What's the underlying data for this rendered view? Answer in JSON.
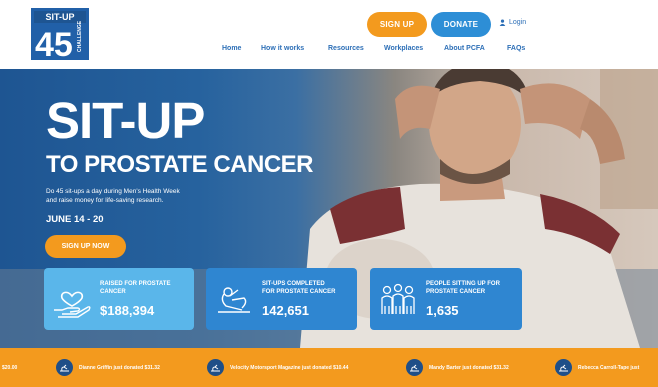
{
  "header": {
    "logo": {
      "top": "SIT-UP",
      "number": "45",
      "side": "CHALLENGE"
    },
    "signup_label": "SIGN UP",
    "donate_label": "DONATE",
    "login_label": "Login",
    "nav": [
      "Home",
      "How it works",
      "Resources",
      "Workplaces",
      "About PCFA",
      "FAQs"
    ]
  },
  "hero": {
    "title": "SIT-UP",
    "subtitle": "TO PROSTATE CANCER",
    "description_line1": "Do 45 sit-ups a day during Men's Health Week",
    "description_line2": "and raise money for life-saving research.",
    "dates": "JUNE 14 - 20",
    "cta_label": "SIGN UP NOW"
  },
  "stats": [
    {
      "label_line1": "RAISED FOR PROSTATE",
      "label_line2": "CANCER",
      "value": "$188,394",
      "icon": "heart-hand-icon"
    },
    {
      "label_line1": "SIT-UPS COMPLETED",
      "label_line2": "FOR PROSTATE CANCER",
      "value": "142,651",
      "icon": "sit-up-person-icon"
    },
    {
      "label_line1": "PEOPLE SITTING UP FOR",
      "label_line2": "PROSTATE CANCER",
      "value": "1,635",
      "icon": "people-group-icon"
    }
  ],
  "ticker": [
    {
      "text": "$20.00"
    },
    {
      "text": "Dianne Griffin just donated $31.32"
    },
    {
      "text": "Velocity Motorsport Magazine just donated $10.44"
    },
    {
      "text": "Mandy Barter just donated $31.32"
    },
    {
      "text": "Rebecca Carroll-Tape just"
    }
  ],
  "colors": {
    "orange": "#f39a1e",
    "blue": "#2d8ed6",
    "navy": "#1e5592",
    "light_blue": "#5ab6ea"
  }
}
